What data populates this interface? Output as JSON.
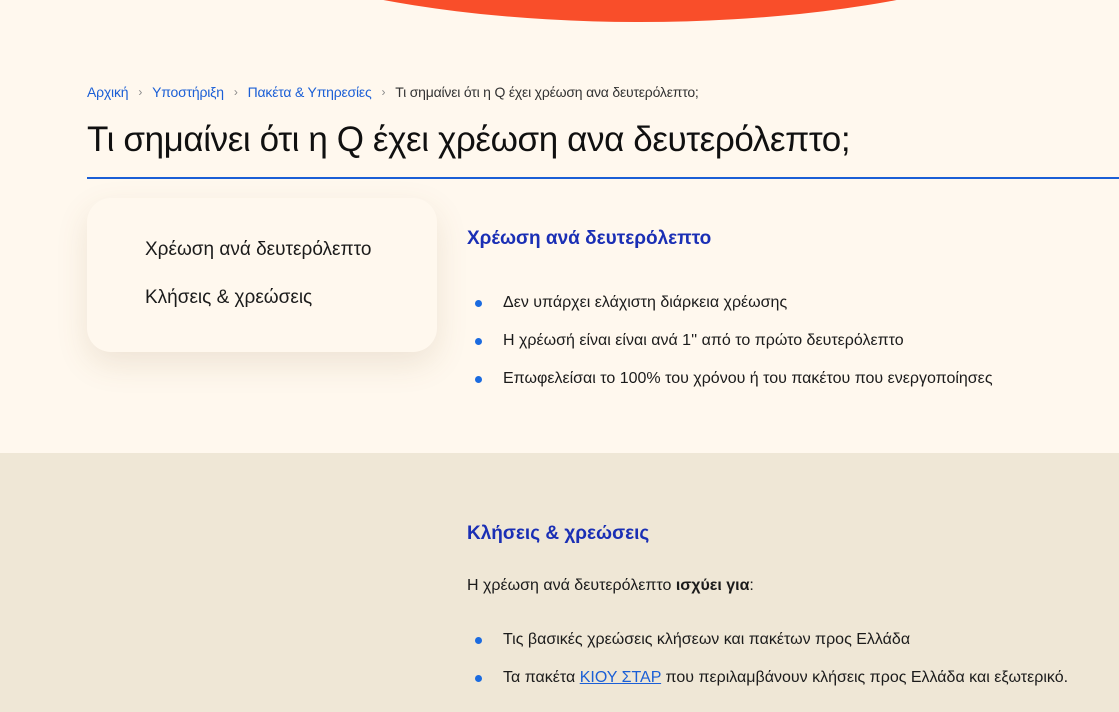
{
  "breadcrumb": {
    "items": [
      "Αρχική",
      "Υποστήριξη",
      "Πακέτα & Υπηρεσίες"
    ],
    "current": "Τι σημαίνει ότι η Q έχει χρέωση ανα δευτερόλεπτο;",
    "separator": "›"
  },
  "page": {
    "title": "Τι σημαίνει ότι η Q έχει χρέωση ανα δευτερόλεπτο;"
  },
  "toc": {
    "items": [
      "Χρέωση ανά δευτερόλεπτο",
      "Κλήσεις & χρεώσεις"
    ]
  },
  "section1": {
    "heading": "Χρέωση ανά δευτερόλεπτο",
    "bullets": [
      "Δεν υπάρχει ελάχιστη διάρκεια χρέωσης",
      "Η χρέωσή είναι είναι ανά 1'' από το πρώτο δευτερόλεπτο",
      "Επωφελείσαι το 100% του χρόνου ή του πακέτου που ενεργοποίησες"
    ]
  },
  "section2": {
    "heading": "Κλήσεις & χρεώσεις",
    "intro_prefix": "Η χρέωση ανά δευτερόλεπτο ",
    "intro_bold": "ισχύει για",
    "intro_suffix": ":",
    "bullet1": "Τις βασικές χρεώσεις κλήσεων και πακέτων προς Ελλάδα",
    "bullet2_prefix": "Τα πακέτα ",
    "bullet2_link": "ΚΙΟΥ ΣΤΑΡ",
    "bullet2_suffix": " που περιλαμβάνουν κλήσεις προς Ελλάδα και εξωτερικό."
  },
  "colors": {
    "accent_orange": "#f94e2a",
    "link_blue": "#1b5fd6",
    "heading_blue": "#1a2fb5",
    "background": "#fff8ee",
    "section2_background": "#efe7d6"
  }
}
